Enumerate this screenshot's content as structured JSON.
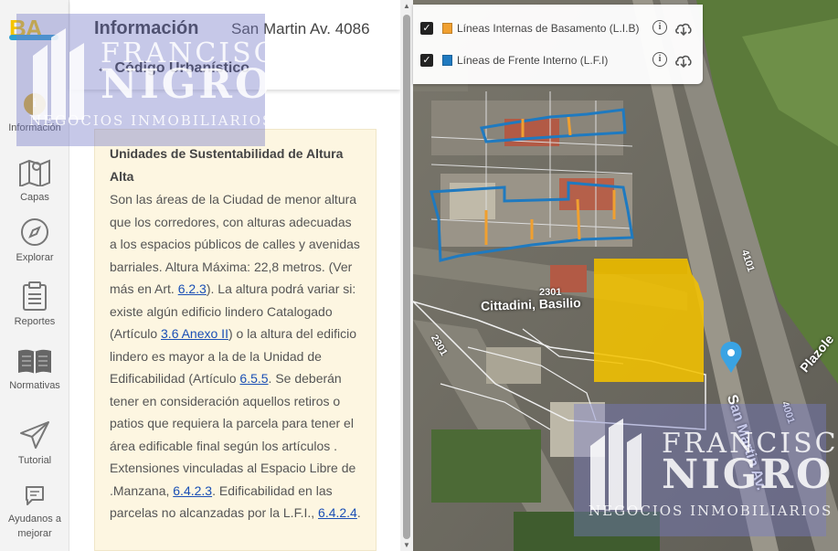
{
  "rail": {
    "items": [
      {
        "label": "Información",
        "icon": "info-icon"
      },
      {
        "label": "Capas",
        "icon": "map-layers-icon"
      },
      {
        "label": "Explorar",
        "icon": "compass-icon"
      },
      {
        "label": "Reportes",
        "icon": "clipboard-icon"
      },
      {
        "label": "Normativas",
        "icon": "book-icon"
      },
      {
        "label": "Tutorial",
        "icon": "paper-plane-icon"
      },
      {
        "label": "Ayudanos a mejorar",
        "icon": "feedback-icon"
      }
    ],
    "logo_text": "BA"
  },
  "panel": {
    "title": "Información",
    "address": "San Martin Av. 4086",
    "back_label": "← Código Urbanístico",
    "card_title": "Unidades de Sustentabilidad de Altura Alta",
    "body": {
      "p1": "Son las áreas de la Ciudad de menor altura que los corredores, con alturas adecuadas a los espacios públicos de calles y avenidas barriales. Altura Máxima: 22,8 metros. (Ver más en Art. ",
      "link1": "6.2.3",
      "p2": "). La altura podrá variar si: existe algún edificio lindero Catalogado (Artículo ",
      "link2": "3.6 Anexo II",
      "p3": ") o la altura del edificio lindero es mayor a la de la Unidad de Edificabilidad (Artículo ",
      "link3": "6.5.5",
      "p4": ". Se deberán tener en consideración aquellos retiros o patios que requiera la parcela para tener el área edificable final según los artículos . Extensiones vinculadas al Espacio Libre de .Manzana, ",
      "link4": "6.4.2.3",
      "p5": ". Edificabilidad en las parcelas no alcanzadas por la L.F.I., ",
      "link5": "6.4.2.4",
      "p6": "."
    }
  },
  "layers": [
    {
      "name": "Líneas Internas de Basamento (L.I.B)",
      "color": "#f0a030",
      "checked": true
    },
    {
      "name": "Líneas de Frente Interno (L.F.I)",
      "color": "#1f7ac0",
      "checked": true
    }
  ],
  "map": {
    "labels": {
      "parcel1": "2301",
      "street_name": "Cittadini, Basilio",
      "parcel2": "2301",
      "avenue": "San Martin Av.",
      "num1": "4001",
      "num2": "4101",
      "plaza": "Plazole"
    },
    "colors": {
      "highlight": "#f2c200",
      "lib": "#f0a030",
      "lfi": "#1f7ac0",
      "pin": "#3aa3e3"
    }
  },
  "watermark": {
    "line1": "FRANCISCO",
    "line2": "NIGRO",
    "line3": "NEGOCIOS INMOBILIARIOS"
  }
}
